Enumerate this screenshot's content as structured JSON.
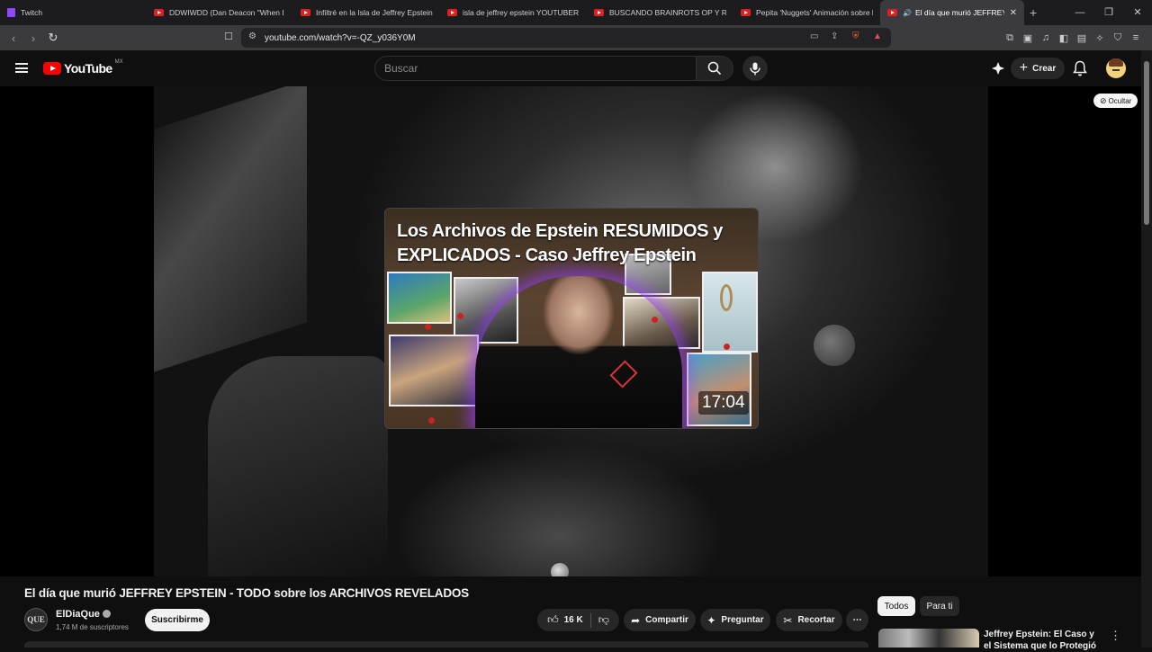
{
  "browser": {
    "tabs": [
      {
        "title": "Twitch",
        "favicon": "twitch-icon"
      },
      {
        "title": "DDWIWDD (Dan Deacon \"When I W",
        "favicon": "youtube-icon"
      },
      {
        "title": "Infiltré en la Isla de Jeffrey Epstein...",
        "favicon": "youtube-icon"
      },
      {
        "title": "isla de jeffrey epstein YOUTUBER QU",
        "favicon": "youtube-icon"
      },
      {
        "title": "BUSCANDO BRAINROTS OP Y REGAL",
        "favicon": "youtube-icon"
      },
      {
        "title": "Pepita 'Nuggets' Animación sobre la",
        "favicon": "youtube-icon"
      },
      {
        "title": "El día que murió JEFFREY EPS",
        "favicon": "youtube-icon",
        "active": true
      }
    ],
    "url": "youtube.com/watch?v=-QZ_y036Y0M"
  },
  "youtube": {
    "logo_text": "YouTube",
    "country_code": "MX",
    "search_placeholder": "Buscar",
    "create_label": "Crear"
  },
  "player": {
    "hide_label": "Ocultar",
    "endscreen": {
      "headline": "Los Archivos de Epstein RESUMIDOS y EXPLICADOS - Caso Jeffrey Epstein",
      "duration": "17:04"
    }
  },
  "video": {
    "title": "El día que murió JEFFREY EPSTEIN - TODO sobre los ARCHIVOS REVELADOS",
    "channel": "ElDiaQue",
    "channel_avatar_text": "QUE",
    "subscribers": "1,74 M de suscriptores",
    "subscribe_label": "Suscribirme",
    "likes": "16 K",
    "share_label": "Compartir",
    "ask_label": "Preguntar",
    "clip_label": "Recortar"
  },
  "sidebar": {
    "chips": [
      "Todos",
      "Para ti"
    ],
    "recommendation_title": "Jeffrey Epstein: El Caso y el Sistema que lo Protegió"
  }
}
